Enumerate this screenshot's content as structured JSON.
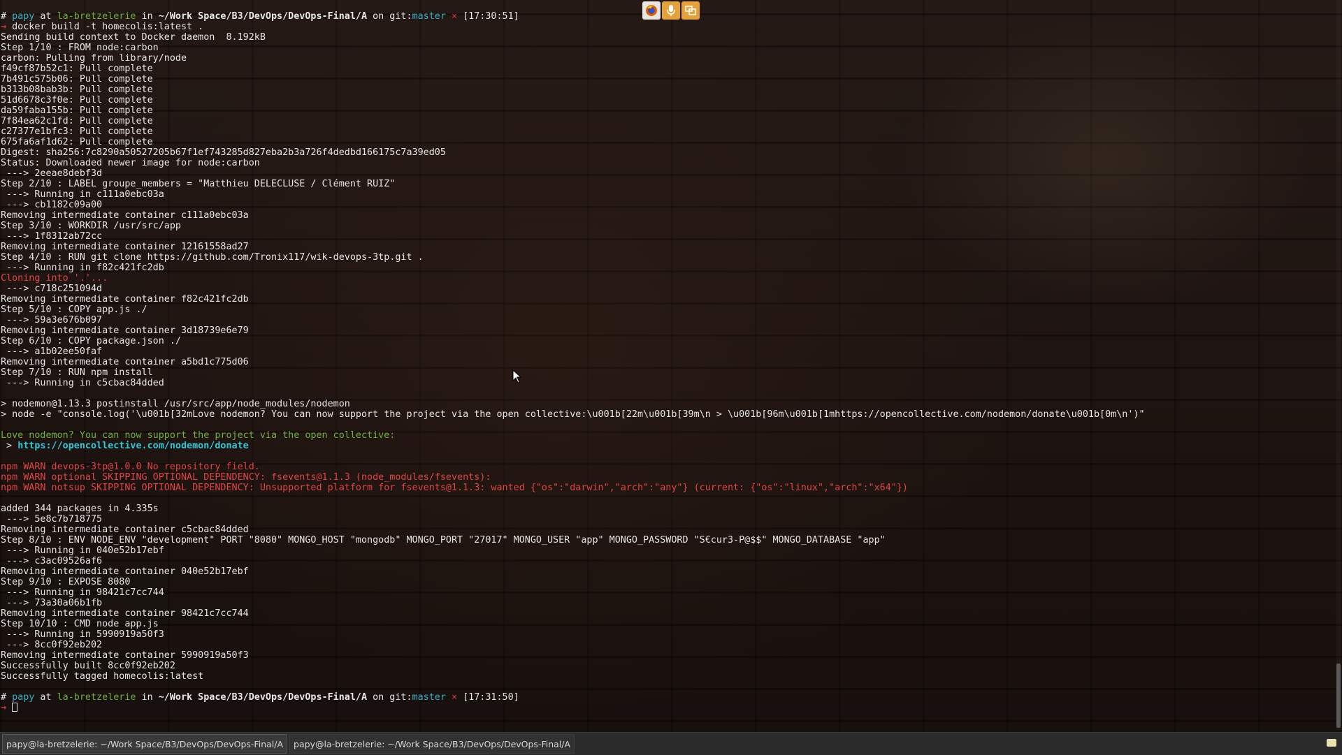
{
  "prompt1": {
    "hash": "#",
    "user": "papy",
    "at": " at ",
    "host": "la-bretzelerie",
    "in": " in ",
    "path": "~/Work Space/B3/DevOps/DevOps-Final/A",
    "on": " on ",
    "git": "git:",
    "branch": "master",
    "dirty": " ×",
    "time": " [17:30:51]"
  },
  "arrow": "→",
  "command": " docker build -t homecolis:latest .",
  "output_a": [
    "Sending build context to Docker daemon  8.192kB",
    "Step 1/10 : FROM node:carbon",
    "carbon: Pulling from library/node",
    "f49cf87b52c1: Pull complete",
    "7b491c575b06: Pull complete",
    "b313b08bab3b: Pull complete",
    "51d6678c3f0e: Pull complete",
    "da59faba155b: Pull complete",
    "7f84ea62c1fd: Pull complete",
    "c27377e1bfc3: Pull complete",
    "675fa6af1d62: Pull complete",
    "Digest: sha256:7c8290a50527205b67f1ef743285d827eba2b3a726f4dedbd166175c7a39ed05",
    "Status: Downloaded newer image for node:carbon",
    " ---> 2eeae8debf3d",
    "Step 2/10 : LABEL groupe_members = \"Matthieu DELECLUSE / Clément RUIZ\"",
    " ---> Running in c111a0ebc03a",
    " ---> cb1182c09a00",
    "Removing intermediate container c111a0ebc03a",
    "Step 3/10 : WORKDIR /usr/src/app",
    " ---> 1f8312ab72cc",
    "Removing intermediate container 12161558ad27",
    "Step 4/10 : RUN git clone https://github.com/Tronix117/wik-devops-3tp.git .",
    " ---> Running in f82c421fc2db"
  ],
  "cloning": "Cloning into '.'...",
  "output_b": [
    " ---> c718c251094d",
    "Removing intermediate container f82c421fc2db",
    "Step 5/10 : COPY app.js ./",
    " ---> 59a3e676b097",
    "Removing intermediate container 3d18739e6e79",
    "Step 6/10 : COPY package.json ./",
    " ---> a1b02ee50faf",
    "Removing intermediate container a5bd1c775d06",
    "Step 7/10 : RUN npm install",
    " ---> Running in c5cbac84dded",
    "",
    "> nodemon@1.13.3 postinstall /usr/src/app/node_modules/nodemon",
    "> node -e \"console.log('\\u001b[32mLove nodemon? You can now support the project via the open collective:\\u001b[22m\\u001b[39m\\n > \\u001b[96m\\u001b[1mhttps://opencollective.com/nodemon/donate\\u001b[0m\\n')\"",
    ""
  ],
  "nodemon_love": "Love nodemon? You can now support the project via the open collective:",
  "nodemon_link_prefix": " > ",
  "nodemon_link": "https://opencollective.com/nodemon/donate",
  "npm_warn": [
    "npm WARN devops-3tp@1.0.0 No repository field.",
    "npm WARN optional SKIPPING OPTIONAL DEPENDENCY: fsevents@1.1.3 (node_modules/fsevents):",
    "npm WARN notsup SKIPPING OPTIONAL DEPENDENCY: Unsupported platform for fsevents@1.1.3: wanted {\"os\":\"darwin\",\"arch\":\"any\"} (current: {\"os\":\"linux\",\"arch\":\"x64\"})"
  ],
  "output_c": [
    "added 344 packages in 4.335s",
    " ---> 5e8c7b718775",
    "Removing intermediate container c5cbac84dded",
    "Step 8/10 : ENV NODE_ENV \"development\" PORT \"8080\" MONGO_HOST \"mongodb\" MONGO_PORT \"27017\" MONGO_USER \"app\" MONGO_PASSWORD \"S€cur3-P@$$\" MONGO_DATABASE \"app\"",
    " ---> Running in 040e52b17ebf",
    " ---> c3ac09526af6",
    "Removing intermediate container 040e52b17ebf",
    "Step 9/10 : EXPOSE 8080",
    " ---> Running in 98421c7cc744",
    " ---> 73a30a06b1fb",
    "Removing intermediate container 98421c7cc744",
    "Step 10/10 : CMD node app.js",
    " ---> Running in 5990919a50f3",
    " ---> 8cc0f92eb202",
    "Removing intermediate container 5990919a50f3",
    "Successfully built 8cc0f92eb202",
    "Successfully tagged homecolis:latest"
  ],
  "prompt2_time": " [17:31:50]",
  "taskbar": {
    "tasks": [
      "papy@la-bretzelerie: ~/Work Space/B3/DevOps/DevOps-Final/A",
      "papy@la-bretzelerie: ~/Work Space/B3/DevOps/DevOps-Final/A"
    ]
  },
  "icons": {
    "tray": [
      "firefox-icon",
      "microphone-icon",
      "window-switch-icon"
    ],
    "notification": "notification-icon",
    "pointer": "mouse-pointer-icon"
  },
  "colors": {
    "prompt_user": "#36b0c8",
    "prompt_host": "#6cae3a",
    "error_red": "#e04545",
    "success_green": "#6fae3f",
    "link_cyan": "#35c7d6",
    "background": "#1b1512"
  }
}
